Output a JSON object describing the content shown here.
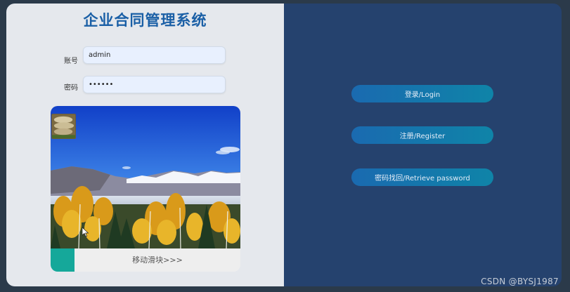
{
  "app": {
    "title": "企业合同管理系统"
  },
  "form": {
    "username_label": "账号",
    "username_value": "admin",
    "password_label": "密码",
    "password_value": "••••••"
  },
  "captcha": {
    "slider_hint": "移动滑块>>>",
    "slider_progress": 0
  },
  "actions": {
    "login_label": "登录/Login",
    "register_label": "注册/Register",
    "retrieve_label": "密码找回/Retrieve password"
  },
  "watermark": "CSDN @BYSJ1987",
  "colors": {
    "left_panel": "#e5e8ed",
    "right_panel": "#25426e",
    "title": "#1a5fa6",
    "button_start": "#1a6ab0",
    "button_end": "#0f84a8",
    "slider_handle": "#15a89a"
  }
}
